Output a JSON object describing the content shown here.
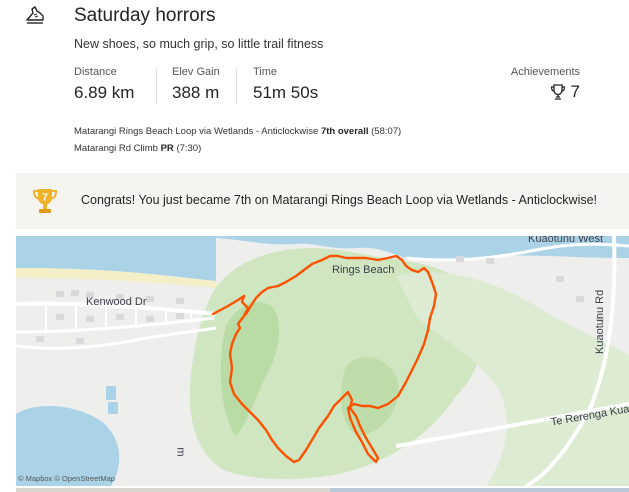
{
  "activity": {
    "title": "Saturday horrors",
    "description": "New shoes, so much grip, so little trail fitness"
  },
  "stats": {
    "distance_label": "Distance",
    "distance_value": "6.89 km",
    "elev_label": "Elev Gain",
    "elev_value": "388 m",
    "time_label": "Time",
    "time_value": "51m 50s",
    "achievements_label": "Achievements",
    "achievements_value": "7"
  },
  "segments": [
    {
      "name": "Matarangi Rings Beach Loop via Wetlands - Anticlockwise",
      "rank": "7th overall",
      "time": "(58:07)"
    },
    {
      "name": "Matarangi Rd Climb",
      "rank": "PR",
      "time": "(7:30)"
    }
  ],
  "banner": {
    "rank_number": "7",
    "text": "Congrats! You just became 7th on Matarangi Rings Beach Loop via Wetlands - Anticlockwise!"
  },
  "map": {
    "labels": {
      "kenwood": "Kenwood Dr",
      "rings_beach": "Rings Beach",
      "kuaotunu_west": "Kuaotunu West",
      "kuaotunu_rd": "Kuaotunu Rd",
      "te_rerenga": "Te Rerenga Kuaotunu Rd",
      "fragment": "m"
    },
    "attribution": "© Mapbox © OpenStreetMap",
    "colors": {
      "route": "#fc5200",
      "water": "#aad3e8",
      "forest": "#cfe6c0",
      "land": "#eeeeed",
      "sand": "#f4efc7"
    }
  }
}
